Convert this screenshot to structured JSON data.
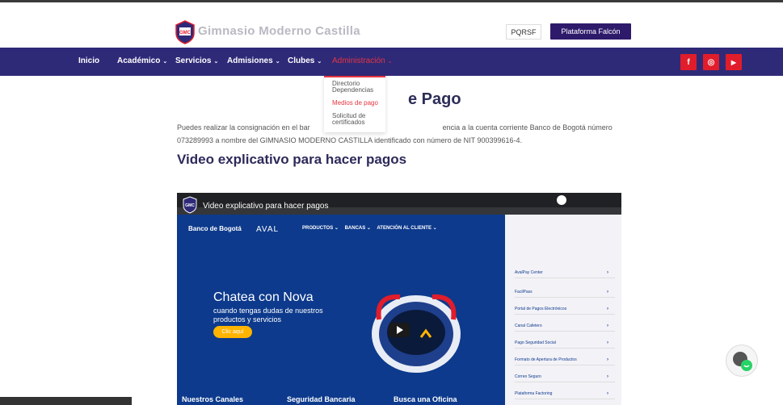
{
  "header": {
    "brand": "Gimnasio Moderno Castilla",
    "pqrsf": "PQRSF",
    "platform_button": "Plataforma Falcón"
  },
  "nav": {
    "items": [
      "Inicio",
      "Académico",
      "Servicios",
      "Admisiones",
      "Clubes",
      "Administración"
    ]
  },
  "social": {
    "facebook": "f",
    "instagram": "◎",
    "youtube": "▶"
  },
  "dropdown": {
    "items": [
      "Directorio Dependencias",
      "Medios de pago",
      "Solicitud de certificados"
    ]
  },
  "page": {
    "title": "e Pago",
    "paragraph_line1a": "Puedes realizar la consignación en el bar",
    "paragraph_line1b": "encia a la cuenta corriente Banco de Bogotá número",
    "paragraph_line2": "073289993 a nombre del GIMNASIO MODERNO CASTILLA identificado con número de NIT 900399616-4.",
    "video_heading": "Video explicativo para hacer pagos"
  },
  "video": {
    "title": "Video explicativo para hacer pagos",
    "bank_logo": "Banco de Bogotá",
    "aval": "AVAL",
    "bank_nav": [
      "PRODUCTOS ⌄",
      "BANCAS ⌄",
      "ATENCIÓN AL CLIENTE ⌄"
    ],
    "chat_title": "Chatea con Nova",
    "chat_sub": "cuando tengas dudas de nuestros productos y servicios",
    "clic": "Clic aquí",
    "bottom_links": [
      "Nuestros Canales",
      "Seguridad Bancaria",
      "Busca una Oficina"
    ],
    "side_items": [
      "AvalPay Center",
      "FacilPass",
      "Portal de Pagos Electrónicos",
      "Canal Cafetero",
      "Pago Seguridad Social",
      "Formato de Apertura de Productos",
      "Correo Seguro",
      "Plataforma Factoring"
    ]
  },
  "colors": {
    "nav_bg": "#2f2a78",
    "accent": "#e5343f",
    "button": "#2e1a6b"
  }
}
